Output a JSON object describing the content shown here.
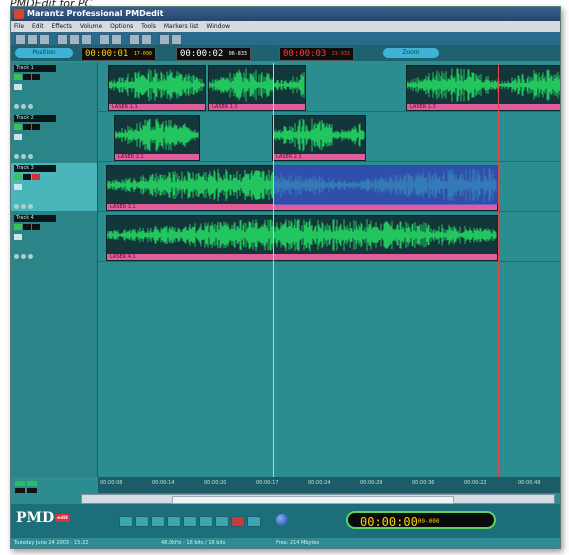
{
  "caption": "PMDEdit for PC",
  "window": {
    "title": "Marantz Professional PMDedit",
    "menu": [
      "File",
      "Edit",
      "Effects",
      "Volume",
      "Options",
      "Tools",
      "Markers list",
      "Window"
    ]
  },
  "transport_top": {
    "left_pill": "Position",
    "tc_start": "00:00:01",
    "tc_start_frames": "17-090",
    "tc_length": "00:00:02",
    "tc_length_frames": "06-833",
    "tc_end": "00:00:03",
    "tc_end_frames": "23-933",
    "zoom_pill": "Zoom"
  },
  "tracks": [
    {
      "name": "Track 1",
      "clips": [
        {
          "label": "LASER 1.1"
        },
        {
          "label": "LASER 1.2"
        },
        {
          "label": "LASER 1.3"
        }
      ]
    },
    {
      "name": "Track 2",
      "clips": [
        {
          "label": "LASER 2.1"
        },
        {
          "label": "LASER 2.2"
        }
      ]
    },
    {
      "name": "Track 3",
      "clips": [
        {
          "label": "LASER 3.1"
        }
      ]
    },
    {
      "name": "Track 4",
      "clips": [
        {
          "label": "LASER 4.1"
        }
      ]
    }
  ],
  "ruler": [
    "00:00:08",
    "00:00:14",
    "00:00:20",
    "00:00:17",
    "00:00:24",
    "00:00:29",
    "00:00:36",
    "00:00:22",
    "00:00:49"
  ],
  "bottom": {
    "logo": "PMD",
    "logo_badge": "edit",
    "main_timecode": "00:00:00",
    "main_timecode_frames": "00-000"
  },
  "status": {
    "date": "Tuesday June 24 2003 - 15:22",
    "format": "48.0kHz - 16 bits / 16 bits",
    "free": "Free: 214 Mbytes"
  },
  "colors": {
    "background": "#2c8d91",
    "waveform": "#22c55e",
    "clip_label": "#e05c9b",
    "selection": "#3c5adc",
    "timecode": "#ffd200"
  }
}
